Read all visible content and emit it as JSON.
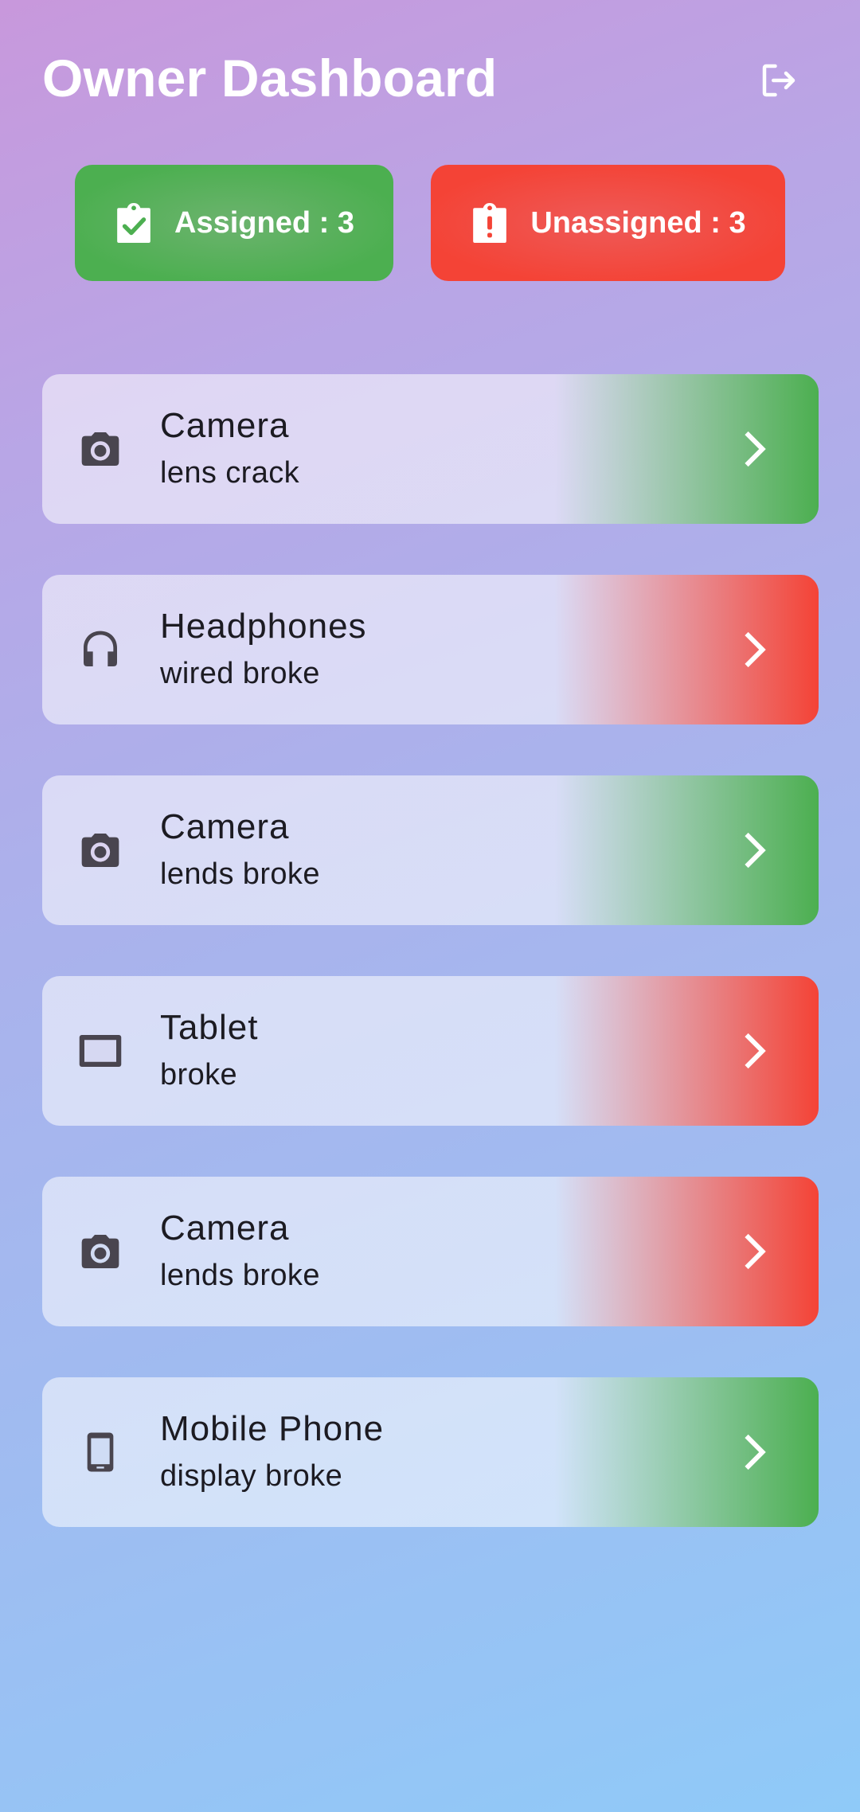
{
  "header": {
    "title": "Owner Dashboard",
    "logout_icon": "logout-icon"
  },
  "stats": {
    "assigned": {
      "label": "Assigned : 3",
      "icon": "clipboard-check-icon",
      "color": "#4caf50"
    },
    "unassigned": {
      "label": "Unassigned : 3",
      "icon": "clipboard-alert-icon",
      "color": "#f44336"
    }
  },
  "colors": {
    "assigned": "#4caf50",
    "unassigned": "#f44336",
    "icon": "#49454f",
    "text": "#1c1b22"
  },
  "items": [
    {
      "device": "Camera",
      "issue": "lens crack",
      "icon": "camera-icon",
      "status": "assigned"
    },
    {
      "device": "Headphones",
      "issue": "wired broke",
      "icon": "headphones-icon",
      "status": "unassigned"
    },
    {
      "device": "Camera",
      "issue": "lends broke",
      "icon": "camera-icon",
      "status": "assigned"
    },
    {
      "device": "Tablet",
      "issue": "broke",
      "icon": "tablet-icon",
      "status": "unassigned"
    },
    {
      "device": "Camera",
      "issue": "lends broke",
      "icon": "camera-icon",
      "status": "unassigned"
    },
    {
      "device": "Mobile Phone",
      "issue": "display broke",
      "icon": "smartphone-icon",
      "status": "assigned"
    }
  ]
}
